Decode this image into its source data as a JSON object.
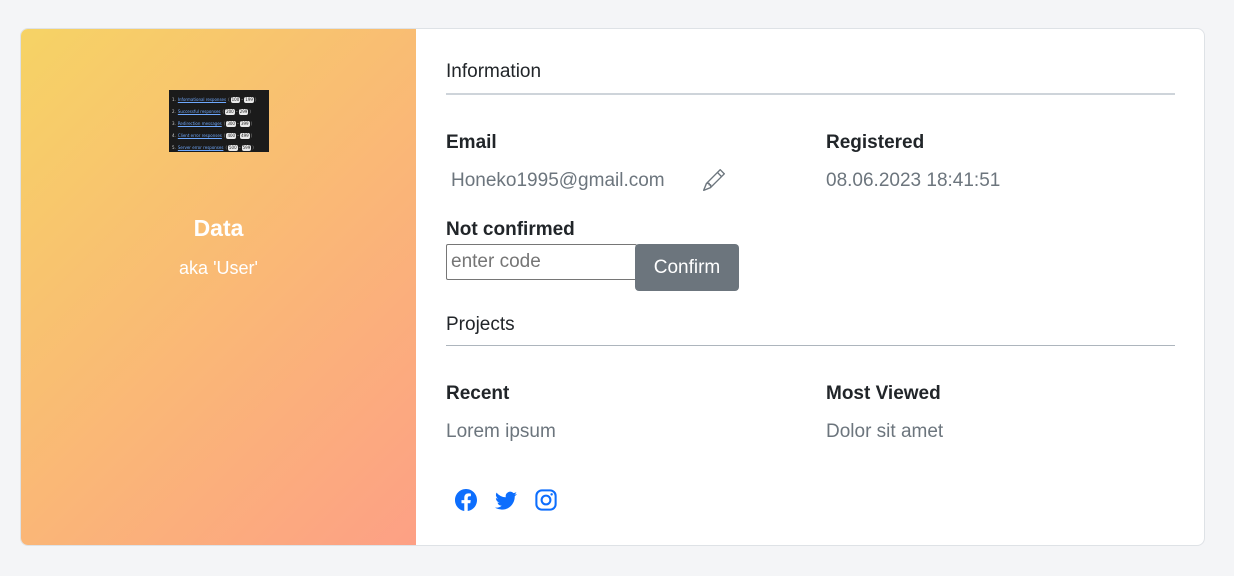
{
  "profile": {
    "name": "Data",
    "alias": "aka 'User'",
    "avatar_lines": [
      {
        "num": "1.",
        "link": "Informational responses",
        "from": "100",
        "to": "199"
      },
      {
        "num": "2.",
        "link": "Successful responses",
        "from": "200",
        "to": "299"
      },
      {
        "num": "3.",
        "link": "Redirection messages",
        "from": "300",
        "to": "399"
      },
      {
        "num": "4.",
        "link": "Client error responses",
        "from": "400",
        "to": "499"
      },
      {
        "num": "5.",
        "link": "Server error responses",
        "from": "500",
        "to": "599"
      }
    ]
  },
  "information": {
    "title": "Information",
    "email_label": "Email",
    "email_value": "Honeko1995@gmail.com",
    "registered_label": "Registered",
    "registered_value": "08.06.2023 18:41:51",
    "status_label": "Not confirmed",
    "code_placeholder": "enter code",
    "confirm_label": "Confirm"
  },
  "projects": {
    "title": "Projects",
    "recent_label": "Recent",
    "recent_value": "Lorem ipsum",
    "most_viewed_label": "Most Viewed",
    "most_viewed_value": "Dolor sit amet"
  },
  "social": [
    "facebook-icon",
    "twitter-icon",
    "instagram-icon"
  ],
  "colors": {
    "gradient_start": "#f6d365",
    "gradient_end": "#fda085",
    "button": "#6c757d",
    "social": "#0d6efd"
  }
}
